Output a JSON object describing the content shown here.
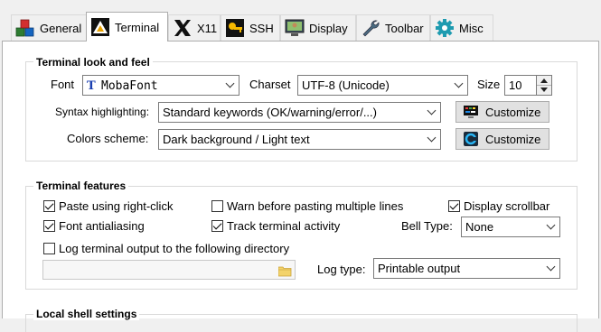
{
  "tabs": [
    {
      "label": "General",
      "icon": "cubes-icon"
    },
    {
      "label": "Terminal",
      "icon": "terminal-icon"
    },
    {
      "label": "X11",
      "icon": "x11-icon"
    },
    {
      "label": "SSH",
      "icon": "key-icon"
    },
    {
      "label": "Display",
      "icon": "monitor-icon"
    },
    {
      "label": "Toolbar",
      "icon": "wrench-icon"
    },
    {
      "label": "Misc",
      "icon": "gear-icon"
    }
  ],
  "look": {
    "title": "Terminal look and feel",
    "font_label": "Font",
    "font_value": "MobaFont",
    "charset_label": "Charset",
    "charset_value": "UTF-8 (Unicode)",
    "size_label": "Size",
    "size_value": "10",
    "syntax_label": "Syntax highlighting:",
    "syntax_value": "Standard keywords (OK/warning/error/...)",
    "customize_label": "Customize",
    "colors_label": "Colors scheme:",
    "colors_value": "Dark background / Light text"
  },
  "features": {
    "title": "Terminal features",
    "paste": {
      "label": "Paste using right-click",
      "checked": true
    },
    "warn": {
      "label": "Warn before pasting multiple lines",
      "checked": false
    },
    "scrollbar": {
      "label": "Display scrollbar",
      "checked": true
    },
    "antialias": {
      "label": "Font antialiasing",
      "checked": true
    },
    "track": {
      "label": "Track terminal activity",
      "checked": true
    },
    "bell_label": "Bell Type:",
    "bell_value": "None",
    "log": {
      "label": "Log terminal output to the following directory",
      "checked": false
    },
    "log_dir": "",
    "log_type_label": "Log type:",
    "log_type_value": "Printable output"
  },
  "local": {
    "title": "Local shell settings"
  }
}
